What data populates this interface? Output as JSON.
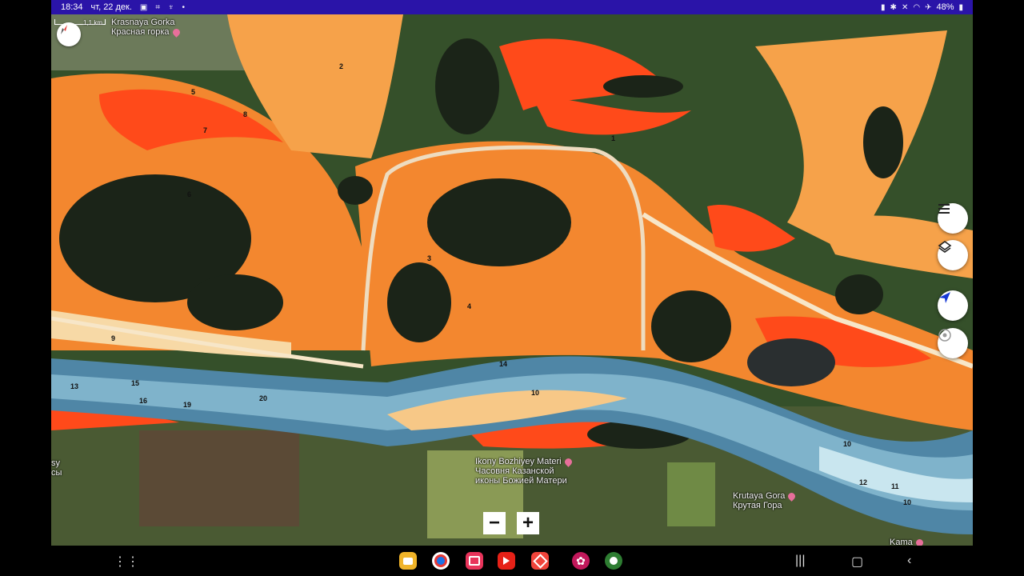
{
  "status_bar": {
    "time": "18:34",
    "date": "чт, 22 дек.",
    "battery": "48%"
  },
  "map": {
    "scale_label": "1,1 km",
    "places": [
      {
        "id": "krasnaya-gorka",
        "en": "Krasnaya Gorka",
        "ru": "Красная горка"
      },
      {
        "id": "ikony",
        "en": "Ikony Bozhiyey Materi",
        "ru1": "Часовня Казанской",
        "ru2": "иконы Божией Матери"
      },
      {
        "id": "krutaya-gora",
        "en": "Krutaya Gora",
        "ru": "Крутая Гора"
      },
      {
        "id": "left-edge",
        "en": "sy",
        "ru": "сы"
      },
      {
        "id": "kama",
        "en": "Kama"
      }
    ],
    "depth_labels": [
      "14",
      "16",
      "19",
      "20",
      "15",
      "13",
      "10",
      "10",
      "12",
      "11",
      "10",
      "9",
      "8",
      "7",
      "6",
      "5",
      "4",
      "3",
      "2",
      "1"
    ],
    "colors": {
      "deep": "#4f86a6",
      "mid": "#a9d3e3",
      "shallow": "#f6a24a",
      "very_shallow": "#ff4a1a",
      "land": "#2f4a26",
      "pond": "#1b2418"
    }
  },
  "controls": {
    "zoom_out": "−",
    "zoom_in": "+"
  },
  "nav": {
    "icons": [
      "apps-grid-icon",
      "files-icon",
      "chrome-icon",
      "camera-icon",
      "youtube-icon",
      "anydesk-icon",
      "flower-icon",
      "bug-icon"
    ],
    "system": [
      "recents-icon",
      "home-icon",
      "back-icon"
    ]
  }
}
